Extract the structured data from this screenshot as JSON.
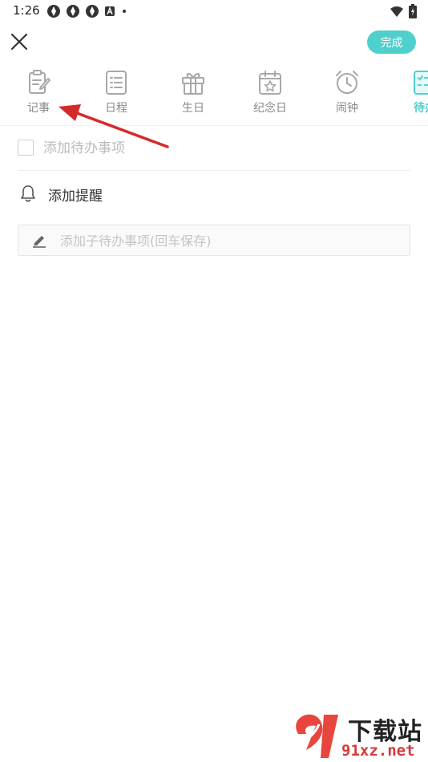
{
  "status_bar": {
    "time": "1:26",
    "icons": [
      "app-notification-icon",
      "app-notification-icon",
      "app-notification-icon",
      "a-badge-icon",
      "dot-icon"
    ],
    "right_icons": [
      "wifi-icon",
      "battery-icon"
    ]
  },
  "top_bar": {
    "done_label": "完成"
  },
  "tabs": [
    {
      "label": "记事",
      "icon": "note-edit-icon",
      "active": false
    },
    {
      "label": "日程",
      "icon": "schedule-list-icon",
      "active": false
    },
    {
      "label": "生日",
      "icon": "gift-icon",
      "active": false
    },
    {
      "label": "纪念日",
      "icon": "calendar-star-icon",
      "active": false
    },
    {
      "label": "闹钟",
      "icon": "alarm-clock-icon",
      "active": false
    },
    {
      "label": "待办",
      "icon": "todo-checklist-icon",
      "active": true
    }
  ],
  "todo": {
    "placeholder": "添加待办事项",
    "value": ""
  },
  "reminder": {
    "label": "添加提醒"
  },
  "subtask": {
    "placeholder": "添加子待办事项(回车保存)",
    "value": ""
  },
  "watermark": {
    "title": "下载站",
    "domain": "91xz.net"
  },
  "colors": {
    "accent": "#4fd0cc",
    "annotation_arrow": "#d62a2a",
    "inactive_icon": "#a8a8a8"
  }
}
